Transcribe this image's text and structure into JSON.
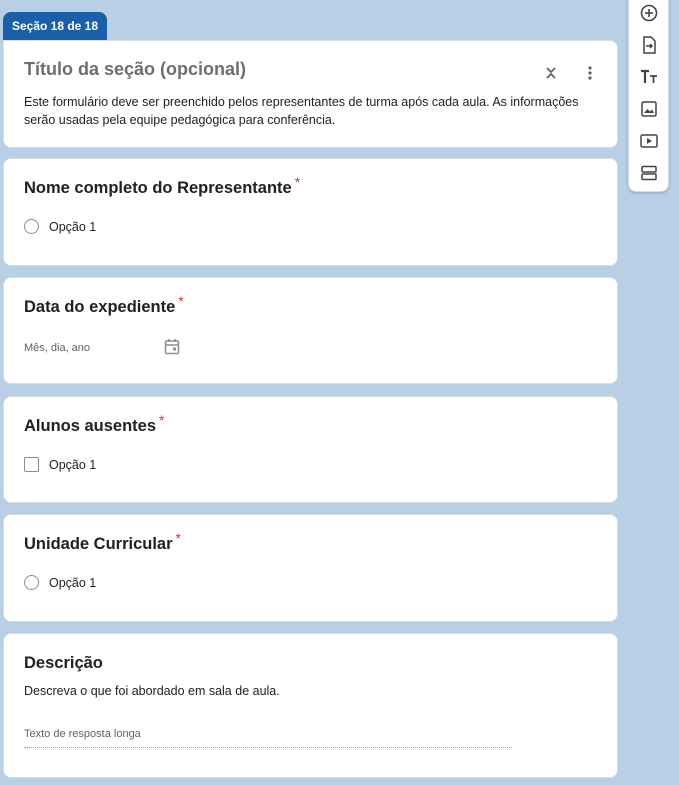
{
  "section_tab": "Seção 18 de 18",
  "header": {
    "title": "Título da seção (opcional)",
    "description": "Este formulário deve ser preenchido pelos representantes de turma após cada aula. As informações serão usadas pela equipe pedagógica para conferência."
  },
  "questions": [
    {
      "title": "Nome completo do Representante",
      "required_mark": "*",
      "option": "Opção 1",
      "type": "radio"
    },
    {
      "title": "Data do expediente",
      "required_mark": "*",
      "placeholder": "Mês, dia, ano",
      "type": "date"
    },
    {
      "title": "Alunos ausentes",
      "required_mark": "*",
      "option": "Opção 1",
      "type": "checkbox"
    },
    {
      "title": "Unidade Curricular",
      "required_mark": "*",
      "option": "Opção 1",
      "type": "radio"
    }
  ],
  "description_block": {
    "title": "Descrição",
    "text": "Descreva o que foi abordado em sala de aula.",
    "placeholder": "Texto de resposta longa"
  },
  "toolbar_icons": [
    "add-question-icon",
    "import-questions-icon",
    "add-title-icon",
    "add-image-icon",
    "add-video-icon",
    "add-section-icon"
  ],
  "colors": {
    "background": "#b9cfe6",
    "accent": "#1a5fa8",
    "required": "#d93025"
  }
}
